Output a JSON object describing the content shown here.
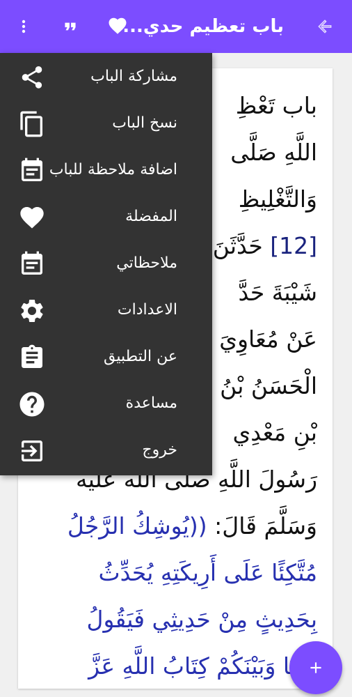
{
  "app_bar": {
    "title": "باب تعظيم حدي...",
    "back_icon": "arrow-forward-icon",
    "favorite_icon": "heart-icon",
    "quote_icon": "format-quote-icon",
    "more_icon": "more-vert-icon",
    "background": "#7c4dff"
  },
  "menu": {
    "items": [
      {
        "label": "مشاركة الباب",
        "icon": "share-icon"
      },
      {
        "label": "نسخ الباب",
        "icon": "copy-icon"
      },
      {
        "label": "اضافة ملاحظة للباب",
        "icon": "add-note-icon"
      },
      {
        "label": "المفضلة",
        "icon": "heart-icon"
      },
      {
        "label": "ملاحظاتي",
        "icon": "notes-icon"
      },
      {
        "label": "الاعدادات",
        "icon": "gear-icon"
      },
      {
        "label": "عن التطبيق",
        "icon": "clipboard-icon"
      },
      {
        "label": "مساعدة",
        "icon": "help-icon"
      },
      {
        "label": "خروج",
        "icon": "exit-icon"
      }
    ],
    "background": "#333333"
  },
  "content": {
    "line1": "باب تَعْظِ",
    "line2": "اللَّهِ صَلَّى",
    "line3": "وَالتَّغْلِيظِ",
    "hadith_number": "[12]",
    "line4_rest": "حَدَّثَنَ",
    "line5": "شَيْبَةَ حَدَّ",
    "line6": "عَنْ مُعَاوِيَ",
    "line7": "الْحَسَنُ بْنُ",
    "line8": "بْنِ مَعْدِي",
    "line9": "رَسُولَ اللَّهِ صلى الله عليه",
    "line10_plain": "وَسَلَّمَ قَالَ: ",
    "line10_quote": "((يُوشِكُ الرَّجُلُ",
    "line11": "مُتَّكِئًا عَلَى أَرِيكَتِهِ يُحَدِّثُ",
    "line12": "بِحَدِيثٍ مِنْ حَدِيثِي فَيَقُولُ",
    "line13": "بَيْنَنَا وَبَيْنَكُمْ كِتَابُ اللَّهِ عَزَّ"
  },
  "fab": {
    "icon": "add-icon",
    "color": "#7c4dff"
  }
}
